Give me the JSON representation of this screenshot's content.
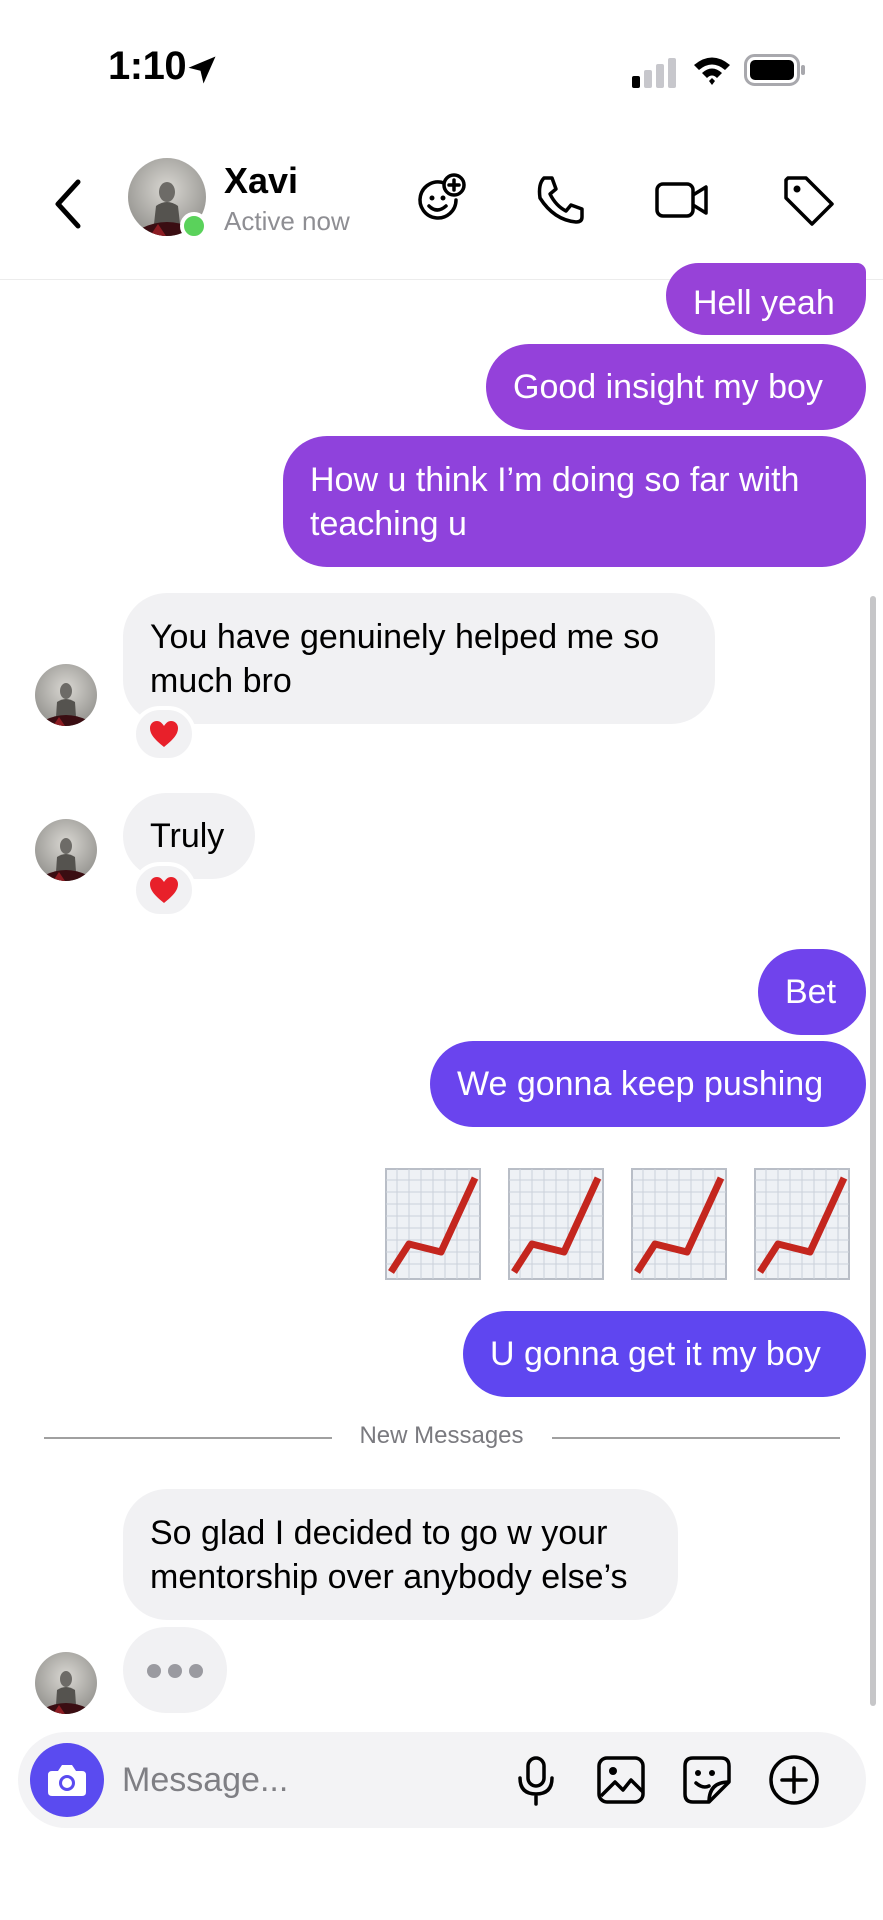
{
  "status_bar": {
    "time": "1:10"
  },
  "header": {
    "contact_name": "Xavi",
    "contact_status": "Active now",
    "icons": [
      "back-icon",
      "avatar",
      "add-emoji-icon",
      "phone-icon",
      "video-icon",
      "tag-icon"
    ]
  },
  "colors": {
    "outgoing_purple": "#9640dc",
    "outgoing_violet": "#6c44f0",
    "outgoing_blue": "#5e46f0",
    "incoming_gray": "#f1f1f3",
    "online_green": "#5ad25b"
  },
  "messages": [
    {
      "id": "m1",
      "dir": "out",
      "text": "Hell yeah"
    },
    {
      "id": "m2",
      "dir": "out",
      "text": "Good insight my boy"
    },
    {
      "id": "m3",
      "dir": "out",
      "line1": "How u think I’m doing so far with",
      "line2": "teaching u"
    },
    {
      "id": "m4",
      "dir": "in",
      "line1": "You have genuinely helped me so",
      "line2": "much bro",
      "reaction": "❤️"
    },
    {
      "id": "m5",
      "dir": "in",
      "text": "Truly",
      "reaction": "❤️"
    },
    {
      "id": "m6",
      "dir": "out",
      "text": "Bet"
    },
    {
      "id": "m7",
      "dir": "out",
      "text": "We gonna keep pushing"
    },
    {
      "id": "m8",
      "dir": "out",
      "emoji": "📈📈📈📈"
    },
    {
      "id": "m9",
      "dir": "out",
      "text": "U gonna get it my boy"
    },
    {
      "id": "m10",
      "dir": "in",
      "line1": "So glad I decided to go w your",
      "line2": "mentorship over anybody else’s"
    }
  ],
  "divider": {
    "label": "New Messages"
  },
  "composer": {
    "placeholder": "Message...",
    "icons": [
      "camera-icon",
      "microphone-icon",
      "gallery-icon",
      "sticker-icon",
      "plus-icon"
    ]
  }
}
